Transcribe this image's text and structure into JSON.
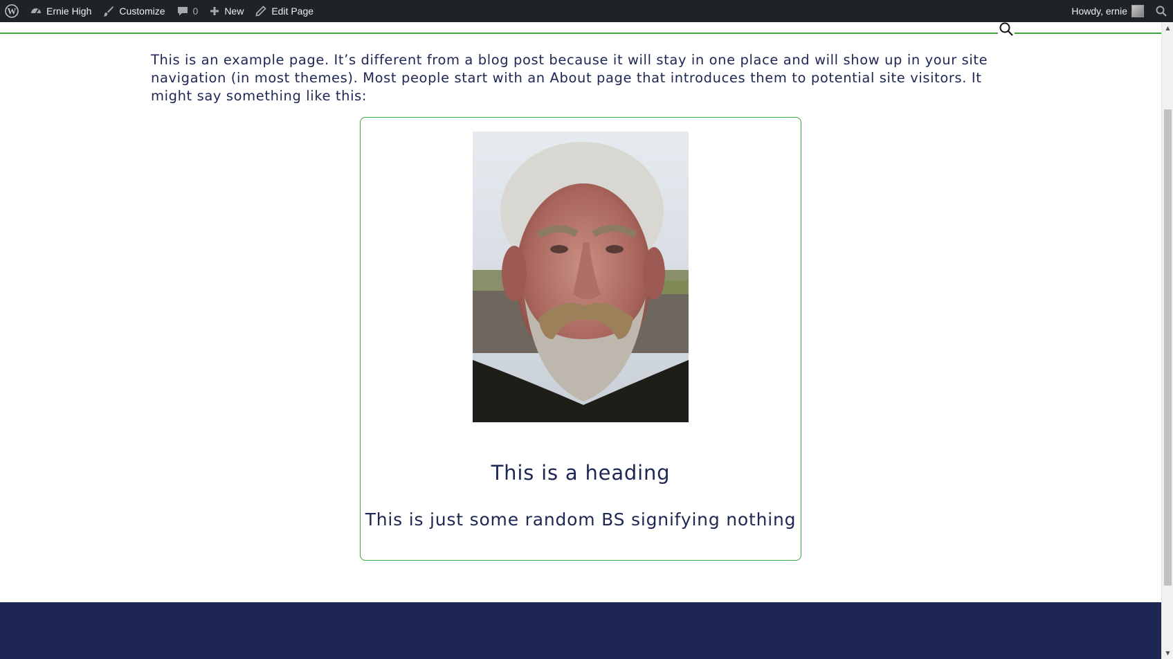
{
  "adminbar": {
    "site_name": "Ernie High",
    "customize_label": "Customize",
    "comments_count": "0",
    "new_label": "New",
    "edit_label": "Edit Page",
    "howdy": "Howdy, ernie"
  },
  "page": {
    "intro": "This is an example page. It’s different from a blog post because it will stay in one place and will show up in your site navigation (in most themes). Most people start with an About page that introduces them to potential site visitors. It might say something like this:",
    "card_heading": "This is a heading",
    "card_text": "This is just some random BS signifying nothing"
  },
  "colors": {
    "accent_green": "#3aa53a",
    "text_navy": "#1d2753",
    "footer_navy": "#1e2654",
    "adminbar_bg": "#1d2327"
  },
  "icons": [
    "wordpress-logo-icon",
    "dashboard-icon",
    "brush-icon",
    "comment-icon",
    "plus-icon",
    "pencil-icon",
    "search-icon"
  ]
}
